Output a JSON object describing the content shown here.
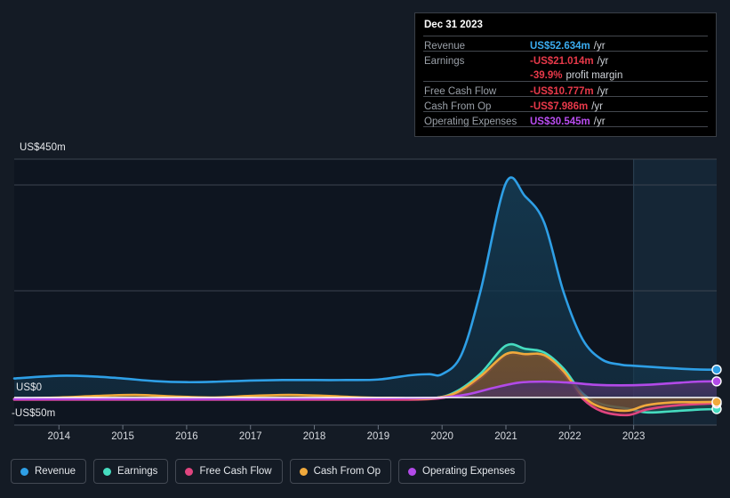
{
  "chart_data": {
    "type": "area",
    "title": "",
    "xlabel": "",
    "ylabel": "",
    "grid": true,
    "legend_position": "bottom-left",
    "currency_prefix": "US$",
    "units": "m",
    "ylim": [
      -50,
      450
    ],
    "y_ticks": [
      450,
      0,
      -50
    ],
    "y_tick_labels": [
      "US$450m",
      "US$0",
      "-US$50m"
    ],
    "x_ticks": [
      2014,
      2015,
      2016,
      2017,
      2018,
      2019,
      2020,
      2021,
      2022,
      2023
    ],
    "x_tick_labels": [
      "2014",
      "2015",
      "2016",
      "2017",
      "2018",
      "2019",
      "2020",
      "2021",
      "2022",
      "2023"
    ],
    "xlim": [
      2013.3,
      2024.3
    ],
    "forecast_band": {
      "start": 2023.0,
      "end": 2024.3
    },
    "series": [
      {
        "name": "Revenue",
        "color": "#2e9fe6",
        "fill": "#14384f",
        "x": [
          2013.3,
          2014.0,
          2014.5,
          2015.0,
          2015.5,
          2016.0,
          2016.5,
          2017.0,
          2017.5,
          2018.0,
          2018.5,
          2019.0,
          2019.5,
          2019.8,
          2020.0,
          2020.3,
          2020.6,
          2021.0,
          2021.3,
          2021.6,
          2021.9,
          2022.2,
          2022.5,
          2022.8,
          2023.0,
          2023.5,
          2024.0,
          2024.3
        ],
        "values": [
          36.0,
          41.0,
          40.0,
          36.0,
          31.0,
          29.0,
          30.0,
          32.0,
          33.0,
          33.0,
          33.0,
          34.0,
          42.0,
          44.0,
          44.0,
          80.0,
          200.0,
          405.0,
          380.0,
          330.0,
          200.0,
          110.0,
          72.0,
          62.0,
          60.0,
          56.0,
          53.0,
          52.634
        ]
      },
      {
        "name": "Earnings",
        "color": "#46dcc0",
        "fill": "#1d5a58",
        "x": [
          2013.3,
          2014.0,
          2015.0,
          2016.0,
          2017.0,
          2018.0,
          2019.0,
          2019.8,
          2020.2,
          2020.6,
          2021.0,
          2021.3,
          2021.6,
          2021.9,
          2022.2,
          2022.5,
          2022.9,
          2023.2,
          2023.6,
          2024.0,
          2024.3
        ],
        "values": [
          -3.0,
          -3.0,
          -3.0,
          -3.0,
          -3.0,
          -3.0,
          -3.0,
          -2.0,
          10.0,
          45.0,
          98.0,
          92.0,
          85.0,
          55.0,
          8.0,
          -12.0,
          -20.0,
          -27.0,
          -25.0,
          -22.0,
          -21.014
        ]
      },
      {
        "name": "Free Cash Flow",
        "color": "#e0457f",
        "fill": "#6b2f3f",
        "x": [
          2013.3,
          2014.0,
          2015.0,
          2016.0,
          2017.0,
          2018.0,
          2019.0,
          2019.8,
          2020.2,
          2020.6,
          2021.0,
          2021.3,
          2021.6,
          2021.9,
          2022.2,
          2022.5,
          2022.9,
          2023.2,
          2023.6,
          2024.0,
          2024.3
        ],
        "values": [
          -4.0,
          -4.0,
          -4.0,
          -4.0,
          -4.0,
          -4.0,
          -4.0,
          -3.0,
          6.0,
          36.0,
          78.0,
          78.0,
          76.0,
          45.0,
          -2.0,
          -25.0,
          -32.0,
          -22.0,
          -15.0,
          -12.0,
          -10.777
        ]
      },
      {
        "name": "Cash From Op",
        "color": "#f0a93c",
        "fill": "#6b5230",
        "x": [
          2013.3,
          2014.0,
          2014.6,
          2015.2,
          2015.8,
          2016.4,
          2017.0,
          2017.6,
          2018.2,
          2018.8,
          2019.4,
          2019.8,
          2020.2,
          2020.6,
          2021.0,
          2021.3,
          2021.6,
          2021.9,
          2022.2,
          2022.5,
          2022.9,
          2023.2,
          2023.6,
          2024.0,
          2024.3
        ],
        "values": [
          -2.0,
          0.0,
          3.0,
          5.0,
          2.0,
          0.0,
          3.0,
          5.0,
          3.0,
          0.0,
          -1.0,
          -2.0,
          8.0,
          40.0,
          82.0,
          82.0,
          80.0,
          50.0,
          3.0,
          -18.0,
          -24.0,
          -14.0,
          -9.0,
          -8.5,
          -7.986
        ]
      },
      {
        "name": "Operating Expenses",
        "color": "#b24ae8",
        "fill": "#4a3366",
        "x": [
          2013.3,
          2015.0,
          2017.0,
          2018.5,
          2019.5,
          2020.0,
          2020.4,
          2020.8,
          2021.2,
          2021.6,
          2022.0,
          2022.4,
          2022.8,
          2023.2,
          2023.6,
          2024.0,
          2024.3
        ],
        "values": [
          -3.0,
          -3.0,
          -3.0,
          -2.0,
          -1.0,
          0.0,
          6.0,
          18.0,
          28.0,
          30.0,
          28.0,
          24.0,
          23.0,
          24.0,
          27.0,
          30.0,
          30.545
        ]
      }
    ]
  },
  "tooltip": {
    "title": "Dec 31 2023",
    "rows": [
      {
        "label": "Revenue",
        "value": "US$52.634m",
        "unit": "/yr",
        "tone": "rev"
      },
      {
        "label": "Earnings",
        "value": "-US$21.014m",
        "unit": "/yr",
        "tone": "neg"
      },
      {
        "label": "",
        "value": "-39.9%",
        "unit": "profit margin",
        "tone": "neg"
      },
      {
        "label": "Free Cash Flow",
        "value": "-US$10.777m",
        "unit": "/yr",
        "tone": "neg"
      },
      {
        "label": "Cash From Op",
        "value": "-US$7.986m",
        "unit": "/yr",
        "tone": "neg"
      },
      {
        "label": "Operating Expenses",
        "value": "US$30.545m",
        "unit": "/yr",
        "tone": "opex"
      }
    ]
  },
  "legend": {
    "items": [
      {
        "label": "Revenue",
        "color": "#2e9fe6"
      },
      {
        "label": "Earnings",
        "color": "#46dcc0"
      },
      {
        "label": "Free Cash Flow",
        "color": "#e0457f"
      },
      {
        "label": "Cash From Op",
        "color": "#f0a93c"
      },
      {
        "label": "Operating Expenses",
        "color": "#b24ae8"
      }
    ]
  }
}
